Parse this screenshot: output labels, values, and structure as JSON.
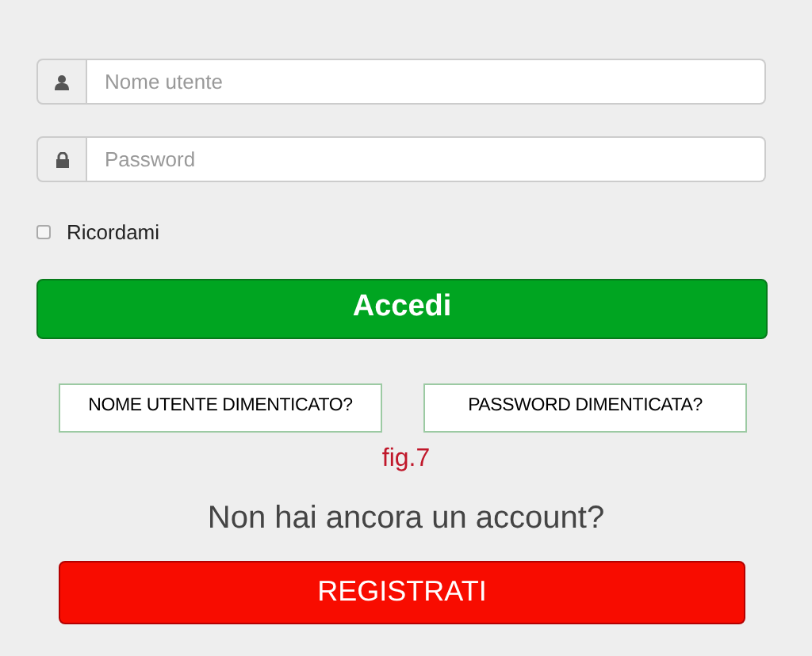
{
  "fields": [
    {
      "kind": "user",
      "placeholder": "Nome utente"
    },
    {
      "kind": "lock",
      "placeholder": "Password"
    }
  ],
  "remember": {
    "label": "Ricordami",
    "checked": false
  },
  "login_button": "Accedi",
  "links": [
    "NOME UTENTE DIMENTICATO?",
    "PASSWORD DIMENTICATA?"
  ],
  "caption": "fig.7",
  "signup_prompt": "Non hai ancora un account?",
  "signup_button": "REGISTRATI"
}
